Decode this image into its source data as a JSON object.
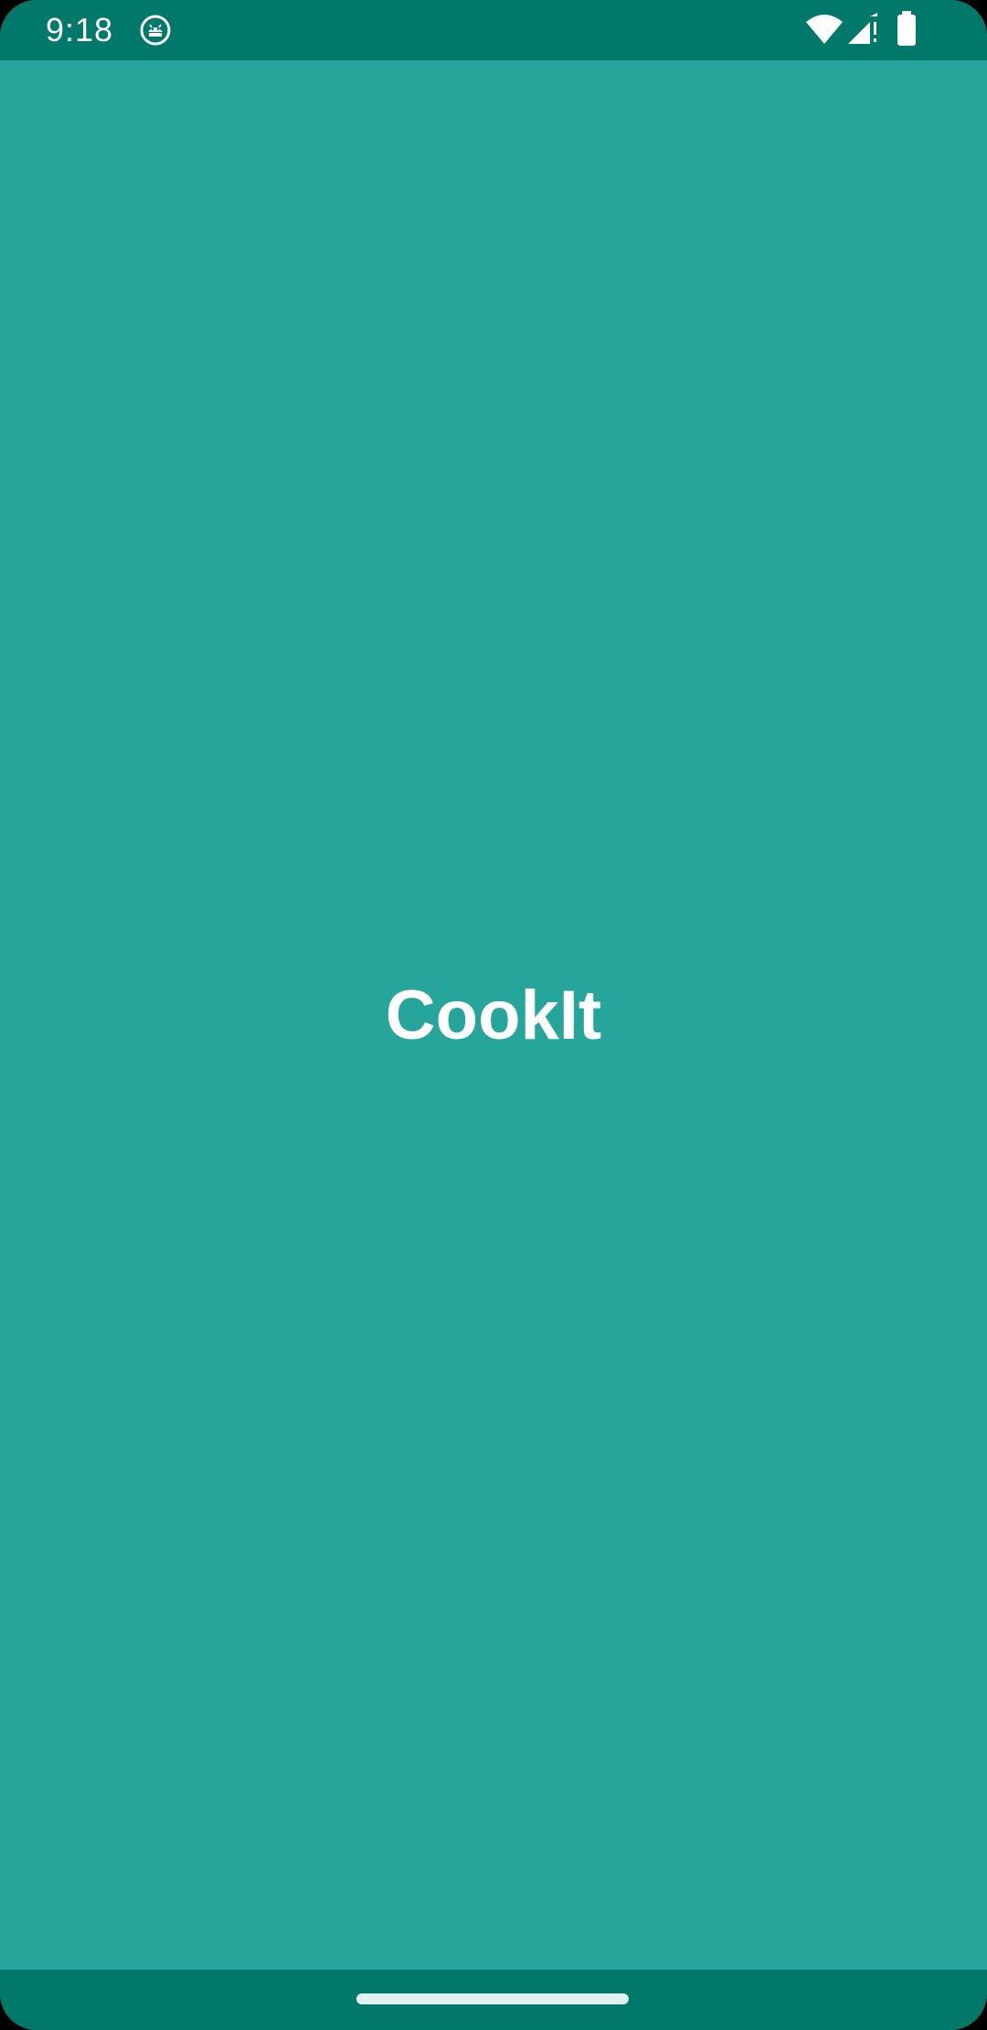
{
  "colors": {
    "status_bar": "#00796B",
    "background": "#26A69A",
    "nav_bar": "#00796B",
    "text": "#FFFFFF"
  },
  "status_bar": {
    "time": "9:18",
    "icons": [
      "android-debug-icon",
      "wifi-icon",
      "cell-signal-icon",
      "battery-icon"
    ]
  },
  "splash": {
    "app_name": "CookIt"
  },
  "nav_bar": {
    "icons": [
      "home-gesture-handle"
    ]
  }
}
